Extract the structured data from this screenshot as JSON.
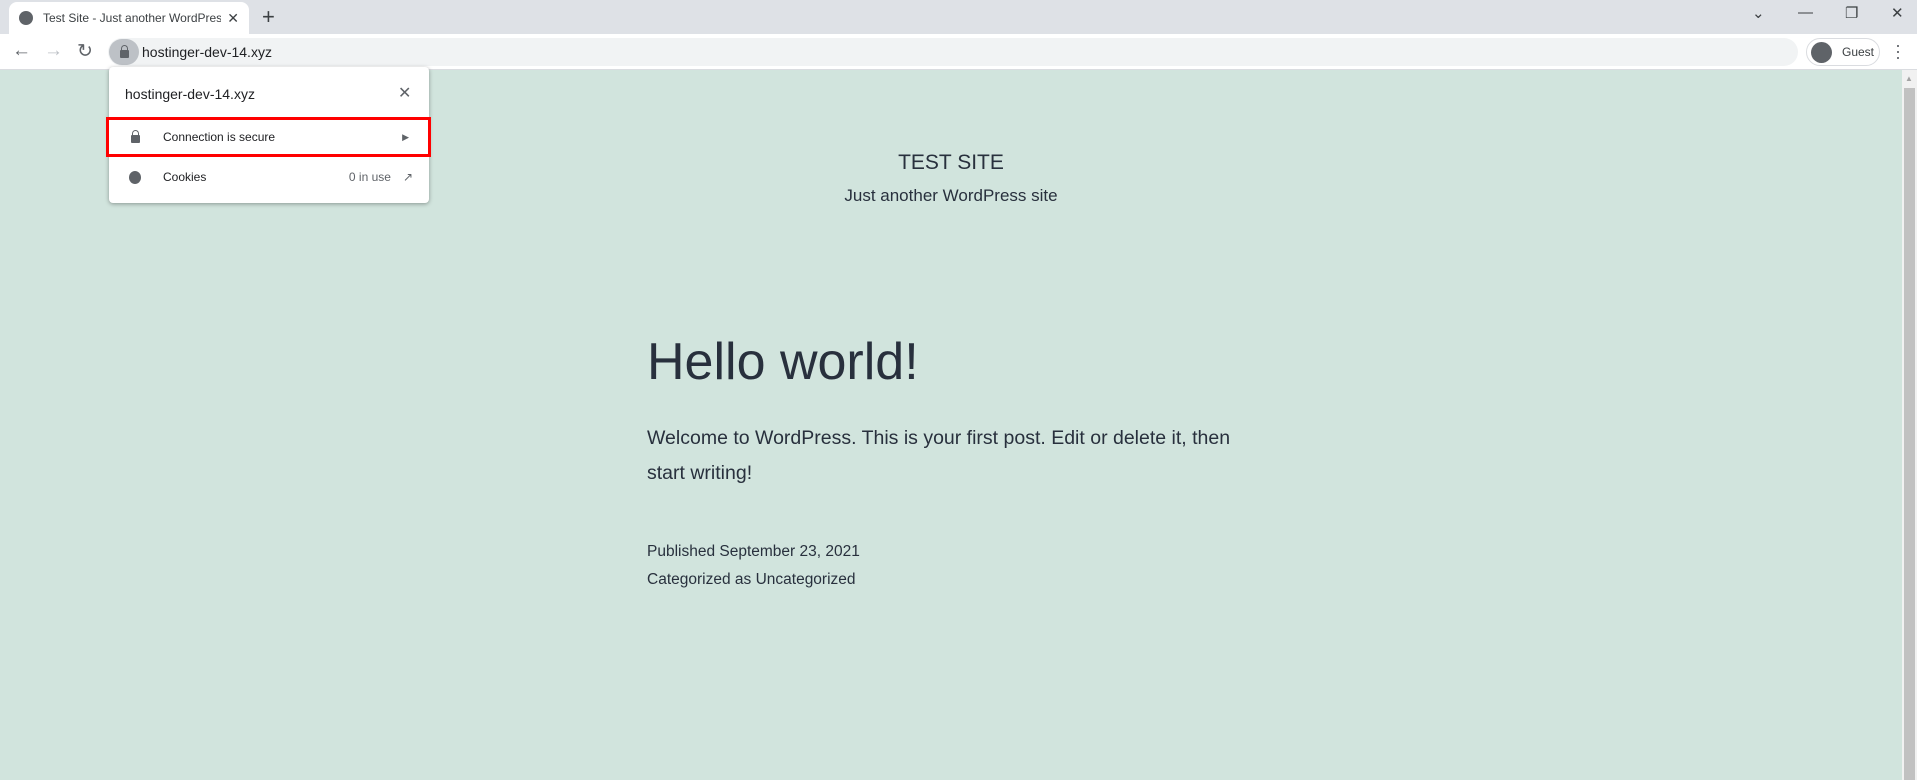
{
  "browser": {
    "tab_title": "Test Site - Just another WordPress site",
    "url": "hostinger-dev-14.xyz",
    "profile": "Guest"
  },
  "popup": {
    "host": "hostinger-dev-14.xyz",
    "connection": "Connection is secure",
    "cookies": "Cookies",
    "cookies_count": "0 in use",
    "highlight_color": "#ff0000"
  },
  "site": {
    "title": "TEST SITE",
    "tagline": "Just another WordPress site"
  },
  "post": {
    "title": "Hello world!",
    "body": "Welcome to WordPress. This is your first post. Edit or delete it, then start writing!",
    "published_prefix": "Published",
    "date": "September 23, 2021",
    "category_prefix": "Categorized as",
    "category": "Uncategorized"
  },
  "colors": {
    "background": "#d1e4dd",
    "text": "#28303d"
  }
}
